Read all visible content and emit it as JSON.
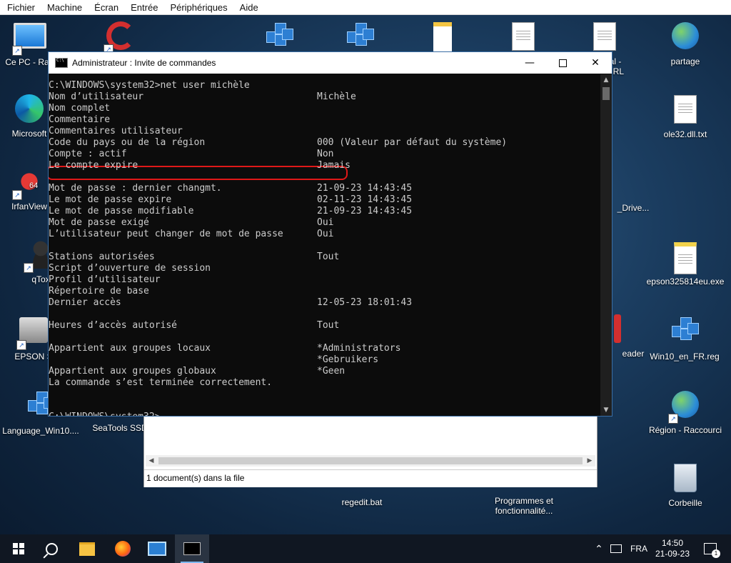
{
  "vm_menu": [
    "Fichier",
    "Machine",
    "Écran",
    "Entrée",
    "Périphériques",
    "Aide"
  ],
  "desktop": {
    "left_icons": [
      "Ce PC - Rac",
      "Microsoft",
      "IrfanView",
      "qTox",
      "EPSON S",
      "Language_Win10...."
    ],
    "top_icons": [
      "",
      "",
      "",
      "",
      "",
      "al -",
      "partage"
    ],
    "right_icons": [
      "ole32.dll.txt",
      "_Drive...",
      "epson325814eu.exe",
      "eader",
      "Win10_en_FR.reg",
      "Région - Raccourci",
      "Corbeille"
    ],
    "partial_labels": [
      "URL"
    ],
    "bottom_icons": [
      "SeaTools SSD",
      "regedit.bat",
      "Programmes et fonctionnalité..."
    ],
    "irfan_badge": "64"
  },
  "file_manager": {
    "status": "1 document(s) dans la file"
  },
  "cmd": {
    "title": "Administrateur : Invite de commandes",
    "buttons": {
      "minimize": "—",
      "close": "✕"
    },
    "lines": [
      {
        "k": "C:\\WINDOWS\\system32>net user michèle",
        "v": ""
      },
      {
        "k": "Nom d’utilisateur",
        "v": "Michèle"
      },
      {
        "k": "Nom complet",
        "v": ""
      },
      {
        "k": "Commentaire",
        "v": ""
      },
      {
        "k": "Commentaires utilisateur",
        "v": ""
      },
      {
        "k": "Code du pays ou de la région",
        "v": "000 (Valeur par défaut du système)"
      },
      {
        "k": "Compte : actif",
        "v": "Non"
      },
      {
        "k": "Le compte expire",
        "v": "Jamais"
      },
      {
        "k": "",
        "v": ""
      },
      {
        "k": "Mot de passe : dernier changmt.",
        "v": "21-09-23 14:43:45"
      },
      {
        "k": "Le mot de passe expire",
        "v": "02-11-23 14:43:45"
      },
      {
        "k": "Le mot de passe modifiable",
        "v": "21-09-23 14:43:45"
      },
      {
        "k": "Mot de passe exigé",
        "v": "Oui"
      },
      {
        "k": "L’utilisateur peut changer de mot de passe",
        "v": "Oui"
      },
      {
        "k": "",
        "v": ""
      },
      {
        "k": "Stations autorisées",
        "v": "Tout"
      },
      {
        "k": "Script d’ouverture de session",
        "v": ""
      },
      {
        "k": "Profil d’utilisateur",
        "v": ""
      },
      {
        "k": "Répertoire de base",
        "v": ""
      },
      {
        "k": "Dernier accès",
        "v": "12-05-23 18:01:43"
      },
      {
        "k": "",
        "v": ""
      },
      {
        "k": "Heures d’accès autorisé",
        "v": "Tout"
      },
      {
        "k": "",
        "v": ""
      },
      {
        "k": "Appartient aux groupes locaux",
        "v": "*Administrators"
      },
      {
        "k": "",
        "v": "*Gebruikers"
      },
      {
        "k": "Appartient aux groupes globaux",
        "v": "*Geen"
      },
      {
        "k": "La commande s’est terminée correctement.",
        "v": ""
      },
      {
        "k": "",
        "v": ""
      },
      {
        "k": "",
        "v": ""
      },
      {
        "k": "C:\\WINDOWS\\system32>",
        "v": ""
      }
    ]
  },
  "taskbar": {
    "language": "FRA",
    "time": "14:50",
    "date": "21-09-23",
    "notifications": "1",
    "tray_chevron": "⌃"
  }
}
